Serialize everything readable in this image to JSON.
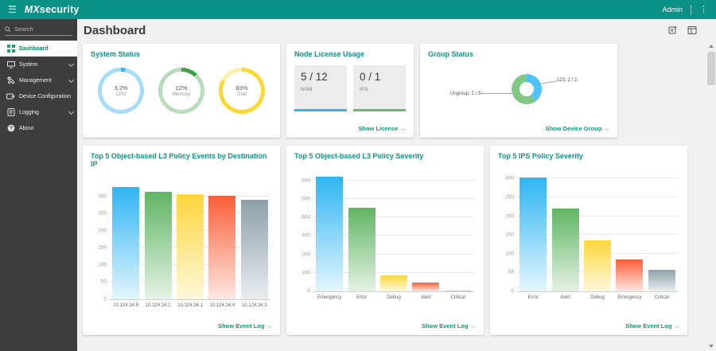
{
  "header": {
    "title": "MXsecurity",
    "title_mx": "MX",
    "title_rest": "security",
    "user": "Admin"
  },
  "sidebar": {
    "search_placeholder": "Search",
    "items": [
      {
        "label": "Dashboard",
        "icon": "dashboard-icon",
        "active": true
      },
      {
        "label": "System",
        "icon": "system-icon",
        "chevron": true
      },
      {
        "label": "Management",
        "icon": "management-icon",
        "chevron": true
      },
      {
        "label": "Device Configuration",
        "icon": "device-configuration-icon"
      },
      {
        "label": "Logging",
        "icon": "logging-icon",
        "chevron": true
      },
      {
        "label": "About",
        "icon": "about-icon"
      }
    ]
  },
  "page": {
    "title": "Dashboard"
  },
  "system_status": {
    "title": "System Status",
    "gauges": [
      {
        "value": "3.2%",
        "label": "CPU",
        "pct": 3.2,
        "color": "#2fb5f3",
        "track": "#a6dcf8"
      },
      {
        "value": "12%",
        "label": "Memory",
        "pct": 12,
        "color": "#43a047",
        "track": "#b9dcba"
      },
      {
        "value": "83%",
        "label": "Disk",
        "pct": 83,
        "color": "#fdd835",
        "track": "#fcefa9"
      }
    ]
  },
  "node_license": {
    "title": "Node License Usage",
    "tiles": [
      {
        "value": "5 / 12",
        "label": "NSM",
        "bar_color": "#2fb5f3"
      },
      {
        "value": "0 / 1",
        "label": "IPS",
        "bar_color": "#66bb6a"
      }
    ],
    "link": "Show License →"
  },
  "group_status": {
    "title": "Group Status",
    "segments": [
      {
        "label": "123: 2 / 2",
        "pct": 40,
        "color": "#4fc3f7"
      },
      {
        "label": "Ungroup: 2 / 3",
        "pct": 60,
        "color": "#81c784"
      }
    ],
    "link": "Show Device Group →"
  },
  "bar_palette": [
    {
      "color": "#2fb5f3",
      "fade": "#e3f5fd"
    },
    {
      "color": "#5fb563",
      "fade": "#e5f2e5"
    },
    {
      "color": "#fdd73a",
      "fade": "#fdf8dc"
    },
    {
      "color": "#f95f38",
      "fade": "#fde8e1"
    },
    {
      "color": "#8da0aa",
      "fade": "#eaedef"
    }
  ],
  "chart_data": [
    {
      "type": "bar",
      "title": "Top 5 Object-based L3 Policy Events by Destination IP",
      "categories": [
        "10.124.34.5",
        "10.124.34.2",
        "10.124.34.1",
        "10.124.34.4",
        "10.124.34.3"
      ],
      "values": [
        328,
        312,
        306,
        302,
        289
      ],
      "ticks": [
        0,
        50,
        100,
        150,
        200,
        250,
        300
      ],
      "ylim": [
        0,
        350
      ],
      "xlabel": "",
      "ylabel": "",
      "link": "Show Event Log →"
    },
    {
      "type": "bar",
      "title": "Top 5 Object-based L3 Policy Severity",
      "categories": [
        "Emergency",
        "Error",
        "Debug",
        "Alert",
        "Critical"
      ],
      "values": [
        620,
        450,
        88,
        48,
        5
      ],
      "ticks": [
        0,
        100,
        200,
        300,
        400,
        500,
        600
      ],
      "ylim": [
        0,
        650
      ],
      "xlabel": "",
      "ylabel": "",
      "link": "Show Event Log →"
    },
    {
      "type": "bar",
      "title": "Top 5 IPS Policy Severity",
      "categories": [
        "Error",
        "Alert",
        "Debug",
        "Emergency",
        "Critical"
      ],
      "values": [
        303,
        220,
        135,
        85,
        58
      ],
      "ticks": [
        0,
        50,
        100,
        150,
        200,
        250,
        300
      ],
      "ylim": [
        0,
        320
      ],
      "xlabel": "",
      "ylabel": "",
      "link": "Show Event Log →"
    }
  ]
}
